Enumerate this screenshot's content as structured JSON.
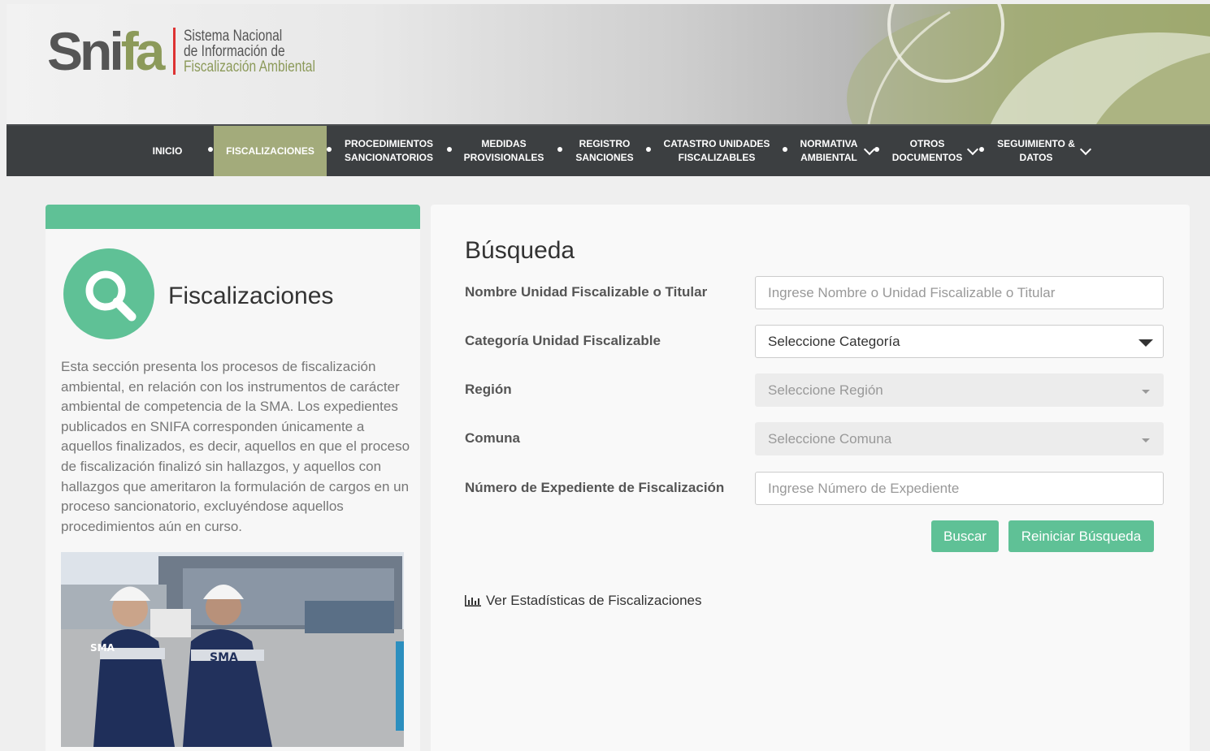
{
  "brand": {
    "logo_main": "Sni",
    "logo_accent": "fa",
    "line1": "Sistema Nacional",
    "line2": "de Información de",
    "line3": "Fiscalización Ambiental",
    "accent_color": "#8c9a5a"
  },
  "nav": {
    "items": [
      {
        "label": "INICIO"
      },
      {
        "label": "FISCALIZACIONES",
        "active": true
      },
      {
        "label": "PROCEDIMIENTOS\nSANCIONATORIOS"
      },
      {
        "label": "MEDIDAS\nPROVISIONALES"
      },
      {
        "label": "REGISTRO\nSANCIONES"
      },
      {
        "label": "CATASTRO UNIDADES\nFISCALIZABLES"
      },
      {
        "label": "NORMATIVA\nAMBIENTAL",
        "dropdown": true
      },
      {
        "label": "OTROS\nDOCUMENTOS",
        "dropdown": true
      },
      {
        "label": "SEGUIMIENTO &\nDATOS",
        "dropdown": true
      }
    ]
  },
  "sidebar": {
    "icon": "search-icon",
    "title": "Fiscalizaciones",
    "description": "Esta sección presenta los procesos de fiscalización ambiental, en relación con los instrumentos de carácter ambiental de competencia de la SMA. Los expedientes publicados en SNIFA corresponden únicamente a aquellos finalizados, es decir, aquellos en que el proceso de fiscalización finalizó sin hallazgos, y aquellos con hallazgos que ameritaron la formulación de cargos en un proceso sancionatorio, excluyéndose aquellos procedimientos aún en curso.",
    "photo_badge_1": "SMA",
    "photo_badge_2": "SMA",
    "accent_color": "#5fc196"
  },
  "search": {
    "title": "Búsqueda",
    "fields": {
      "nombre": {
        "label": "Nombre Unidad Fiscalizable o Titular",
        "placeholder": "Ingrese Nombre o Unidad Fiscalizable o Titular",
        "value": ""
      },
      "categoria": {
        "label": "Categoría Unidad Fiscalizable",
        "selected": "Seleccione Categoría"
      },
      "region": {
        "label": "Región",
        "selected": "Seleccione Región"
      },
      "comuna": {
        "label": "Comuna",
        "selected": "Seleccione Comuna"
      },
      "expediente": {
        "label": "Número de Expediente de Fiscalización",
        "placeholder": "Ingrese Número de Expediente",
        "value": ""
      }
    },
    "buttons": {
      "buscar": "Buscar",
      "reiniciar": "Reiniciar Búsqueda"
    },
    "stats_link": "Ver Estadísticas de Fiscalizaciones"
  }
}
